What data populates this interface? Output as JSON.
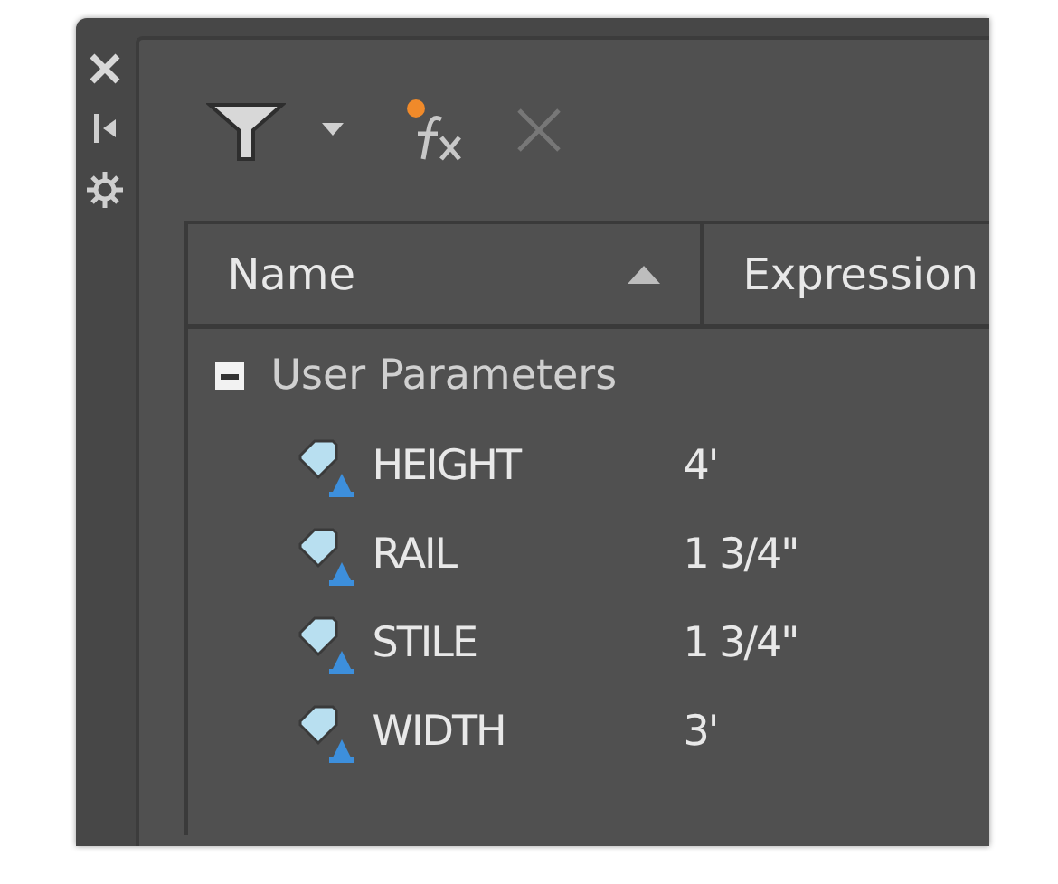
{
  "toolbar": {
    "delete_disabled": true
  },
  "table": {
    "columns": [
      {
        "label": "Name",
        "sorted_ascending": true
      },
      {
        "label": "Expression"
      }
    ],
    "groups": [
      {
        "label": "User Parameters",
        "expanded": true,
        "children": [
          {
            "name": "HEIGHT",
            "expression": "4'"
          },
          {
            "name": "RAIL",
            "expression": "1 3/4\""
          },
          {
            "name": "STILE",
            "expression": "1 3/4\""
          },
          {
            "name": "WIDTH",
            "expression": "3'"
          }
        ]
      }
    ]
  }
}
